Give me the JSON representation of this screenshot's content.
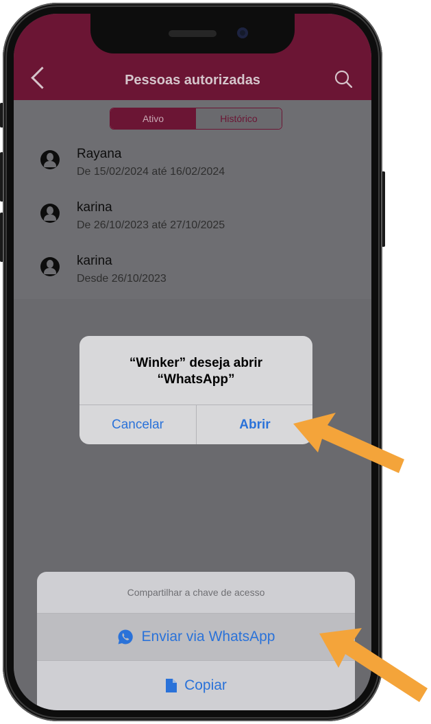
{
  "nav": {
    "title": "Pessoas autorizadas"
  },
  "segments": {
    "active": "Ativo",
    "history": "Histórico"
  },
  "list": {
    "items": [
      {
        "name": "Rayana",
        "period": "De 15/02/2024 até 16/02/2024"
      },
      {
        "name": "karina",
        "period": "De 26/10/2023 até 27/10/2025"
      },
      {
        "name": "karina",
        "period": "Desde 26/10/2023"
      }
    ]
  },
  "alert": {
    "title_line1": "“Winker” deseja abrir",
    "title_line2": "“WhatsApp”",
    "cancel_label": "Cancelar",
    "open_label": "Abrir"
  },
  "sheet": {
    "title": "Compartilhar a chave de acesso",
    "whatsapp_label": "Enviar via WhatsApp",
    "copy_label": "Copiar"
  },
  "colors": {
    "brand": "#6b1534",
    "ios_blue": "#2a72d9",
    "arrow": "#f4a43a"
  },
  "icons": {
    "back": "chevron-left-icon",
    "search": "search-icon",
    "avatar": "person-circle-icon",
    "whatsapp": "whatsapp-icon",
    "copy": "document-icon",
    "arrow": "arrow-icon"
  }
}
